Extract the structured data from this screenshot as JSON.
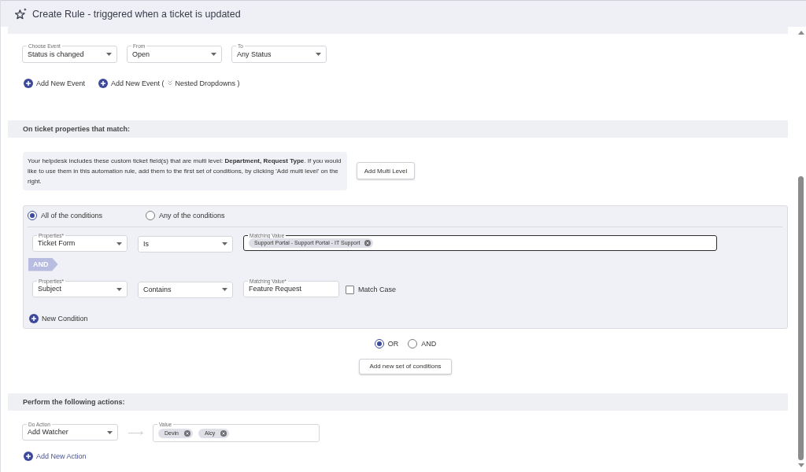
{
  "window": {
    "title": "Create Rule - triggered when a ticket is updated"
  },
  "event_section": {
    "fields": [
      {
        "label": "Choose Event",
        "value": "Status is changed"
      },
      {
        "label": "From",
        "value": "Open"
      },
      {
        "label": "To",
        "value": "Any Status"
      }
    ],
    "links": [
      {
        "kind": "plain",
        "label": "Add New Event",
        "hovered": false
      },
      {
        "kind": "nested",
        "label": "Add New Event (",
        "label_after": "Nested Dropdowns )",
        "hovered": false
      }
    ]
  },
  "conditions_section": {
    "title": "On ticket properties that match:",
    "notice": "Your helpdesk includes these custom ticket field(s) that are multi level: **Department, Request Type**. If you would like to use them in this automation rule, add them to the first set of conditions, by clicking 'Add multi level' on the right.",
    "notice_button": "Add Multi Level",
    "match_modes": [
      {
        "label": "All of the conditions",
        "selected": true
      },
      {
        "label": "Any of the conditions",
        "selected": false
      }
    ],
    "rows": [
      {
        "kind": "condition",
        "property": {
          "label": "Properties*",
          "value": "Ticket Form"
        },
        "operator": {
          "value": "Is"
        },
        "matching": {
          "kind": "tags",
          "label": "Matching Value",
          "focused": true,
          "tags": [
            "Support Portal - Support Portal - IT Support"
          ]
        }
      },
      {
        "kind": "joiner",
        "label": "AND"
      },
      {
        "kind": "condition",
        "property": {
          "label": "Properties*",
          "value": "Subject"
        },
        "operator": {
          "value": "Contains"
        },
        "matching": {
          "kind": "text",
          "label": "Matching Value*",
          "focused": false,
          "value": "Feature Request"
        },
        "match_case": {
          "label": "Match Case",
          "checked": false
        }
      }
    ],
    "new_condition": {
      "kind": "plain",
      "label": "New Condition",
      "hovered": false
    },
    "set_joiners": [
      {
        "label": "OR",
        "selected": true
      },
      {
        "label": "AND",
        "selected": false
      }
    ],
    "add_set_button": "Add new set of conditions"
  },
  "actions_section": {
    "title": "Perform the following actions:",
    "rows": [
      {
        "action": {
          "label": "Do Action",
          "value": "Add Watcher"
        },
        "value": {
          "label": "Value",
          "tags": [
            "Devin",
            "Alcy"
          ]
        }
      }
    ],
    "add_action": {
      "kind": "plain",
      "label": "Add New Action",
      "hovered": true
    }
  }
}
